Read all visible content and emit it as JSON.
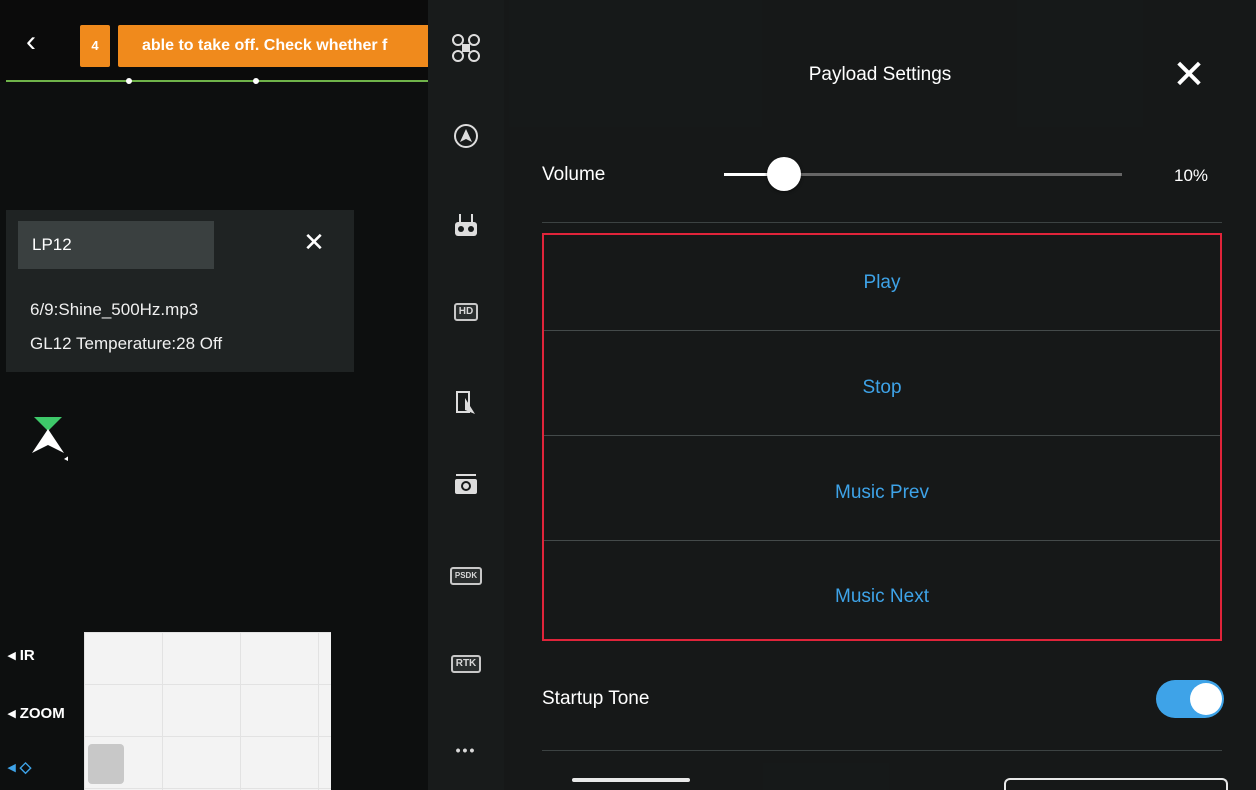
{
  "topbar": {
    "warning_count": "4",
    "warning_message": "able to take off. Check whether f"
  },
  "lp_panel": {
    "tab_label": "LP12",
    "line1": "6/9:Shine_500Hz.mp3",
    "line2": "GL12 Temperature:28 Off"
  },
  "camera": {
    "ir_label": "IR",
    "zoom_label": "ZOOM"
  },
  "toolbar": {
    "icons": [
      "drone-icon",
      "autopilot-icon",
      "remote-controller-icon",
      "hd-icon",
      "flight-route-icon",
      "camera-icon",
      "psdk-icon",
      "rtk-icon",
      "more-icon"
    ],
    "hd_text": "HD",
    "psdk_text": "PSDK",
    "rtk_text": "RTK",
    "more_text": "•••"
  },
  "payload_settings": {
    "title": "Payload Settings",
    "volume_label": "Volume",
    "volume_value": "10%",
    "volume_fraction": 0.1,
    "actions": [
      "Play",
      "Stop",
      "Music Prev",
      "Music Next"
    ],
    "startup_tone_label": "Startup Tone",
    "startup_tone_on": true
  },
  "colors": {
    "accent_blue": "#3ea3e8",
    "warning_orange": "#f08a1c",
    "highlight_red": "#e0243a"
  }
}
